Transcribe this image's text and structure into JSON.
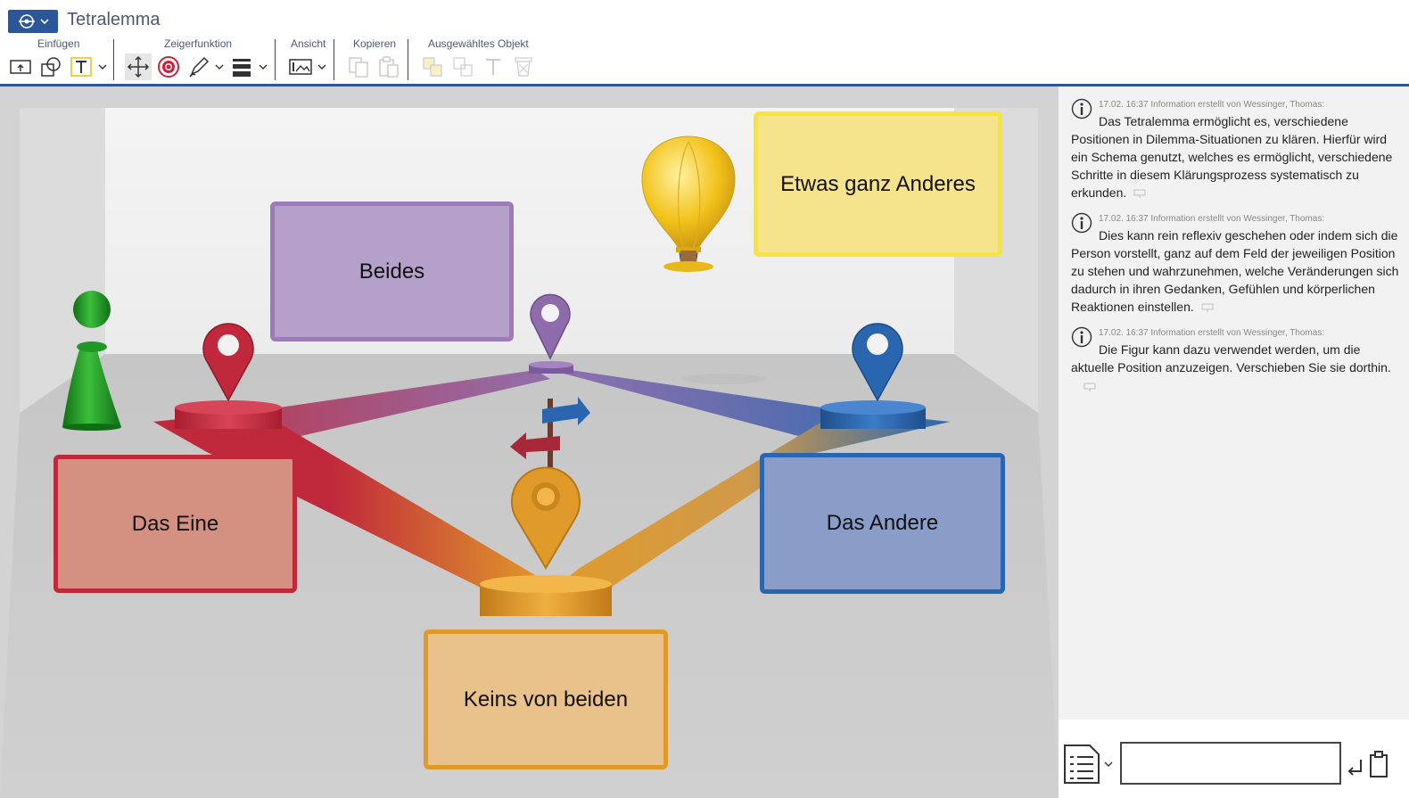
{
  "app": {
    "title": "Tetralemma",
    "menu_icon": "globe-settings-icon"
  },
  "ribbon": {
    "groups": {
      "insert": "Einfügen",
      "pointer": "Zeigerfunktion",
      "view": "Ansicht",
      "copy": "Kopieren",
      "selected": "Ausgewähltes Objekt"
    }
  },
  "canvas": {
    "boxes": {
      "beides": "Beides",
      "etwas": "Etwas ganz Anderes",
      "eine": "Das Eine",
      "andere": "Das Andere",
      "keins": "Keins von beiden"
    },
    "colors": {
      "red": "#c0283c",
      "purple": "#8e6bab",
      "blue": "#2a66b0",
      "orange": "#e09a2a",
      "yellow": "#f5e37a",
      "green": "#1e9a24"
    }
  },
  "panel": {
    "entries": [
      {
        "meta": "17.02. 16:37 Information erstellt von Wessinger, Thomas:",
        "text": "Das Tetralemma ermöglicht es, verschiedene Positionen in Dilemma-Situationen zu klären. Hierfür wird ein Schema genutzt, welches es ermöglicht, verschiedene Schritte in diesem Klärungsprozess systematisch zu erkunden."
      },
      {
        "meta": "17.02. 16:37 Information erstellt von Wessinger, Thomas:",
        "text": "Dies kann rein reflexiv geschehen oder indem sich die Person vorstellt, ganz auf dem Feld der jeweiligen Position zu stehen und wahrzunehmen, welche Veränderungen sich dadurch in ihren Gedanken, Gefühlen und körperlichen Reaktionen einstellen."
      },
      {
        "meta": "17.02. 16:37 Information erstellt von Wessinger, Thomas:",
        "text": "Die Figur kann dazu verwendet werden, um die aktuelle Position anzuzeigen. Verschieben Sie sie dorthin."
      }
    ],
    "input": {
      "value": "",
      "placeholder": ""
    }
  }
}
